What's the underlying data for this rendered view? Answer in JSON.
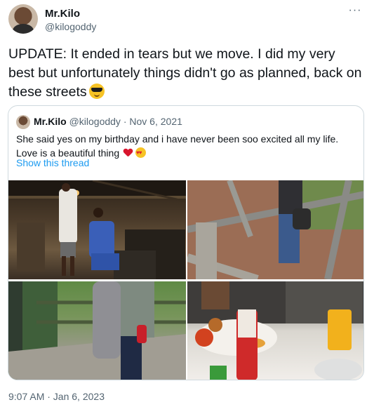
{
  "tweet": {
    "author_name": "Mr.Kilo",
    "author_handle": "@kilogoddy",
    "more_label": "···",
    "text": "UPDATE: It ended in tears but we move. I did my very best but unfortunately things didn't go as planned, back on these streets",
    "emoji": "smiling-face-with-sunglasses",
    "timestamp": "9:07 AM · Jan 6, 2023"
  },
  "quoted": {
    "author_name": "Mr.Kilo",
    "author_handle": "@kilogoddy",
    "separator": "·",
    "date": "Nov 6, 2021",
    "text": "She said yes on my birthday and i have never been soo excited all my life. Love is a beautiful thing",
    "emojis": [
      "red-heart",
      "smiling-face-with-heart-eyes"
    ],
    "show_thread": "Show this thread",
    "photos": [
      "proposal-photo",
      "walkway-photo",
      "balcony-photo",
      "breakfast-photo"
    ]
  }
}
